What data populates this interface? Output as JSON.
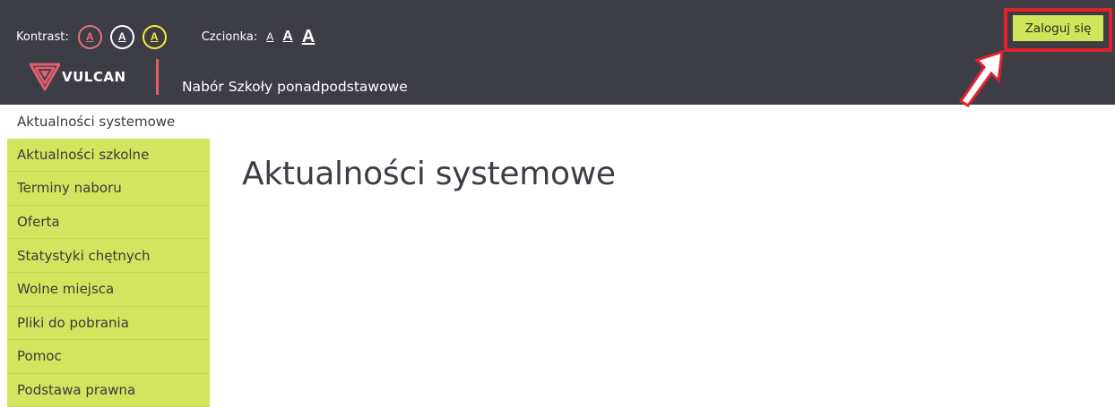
{
  "header": {
    "contrast_label": "Kontrast:",
    "contrast_options": [
      {
        "letter": "A",
        "color": "#e8707c",
        "name": "contrast-default-button"
      },
      {
        "letter": "A",
        "color": "#ffffff",
        "name": "contrast-white-button"
      },
      {
        "letter": "A",
        "color": "#f5ed3b",
        "name": "contrast-yellow-button"
      }
    ],
    "font_label": "Czcionka:",
    "font_sizes": [
      "A",
      "A",
      "A"
    ],
    "logo_text": "VULCAN",
    "app_title": "Nabór Szkoły ponadpodstawowe",
    "login_label": "Zaloguj się",
    "colors": {
      "header_bg": "#3d3d46",
      "accent_green": "#d3e45e",
      "logo_red": "#e15f6d",
      "highlight_red": "#e3202c"
    }
  },
  "sidebar": {
    "items": [
      {
        "label": "Aktualności systemowe",
        "active": true
      },
      {
        "label": "Aktualności szkolne",
        "active": false
      },
      {
        "label": "Terminy naboru",
        "active": false
      },
      {
        "label": "Oferta",
        "active": false
      },
      {
        "label": "Statystyki chętnych",
        "active": false
      },
      {
        "label": "Wolne miejsca",
        "active": false
      },
      {
        "label": "Pliki do pobrania",
        "active": false
      },
      {
        "label": "Pomoc",
        "active": false
      },
      {
        "label": "Podstawa prawna",
        "active": false
      }
    ]
  },
  "main": {
    "title": "Aktualności systemowe"
  }
}
